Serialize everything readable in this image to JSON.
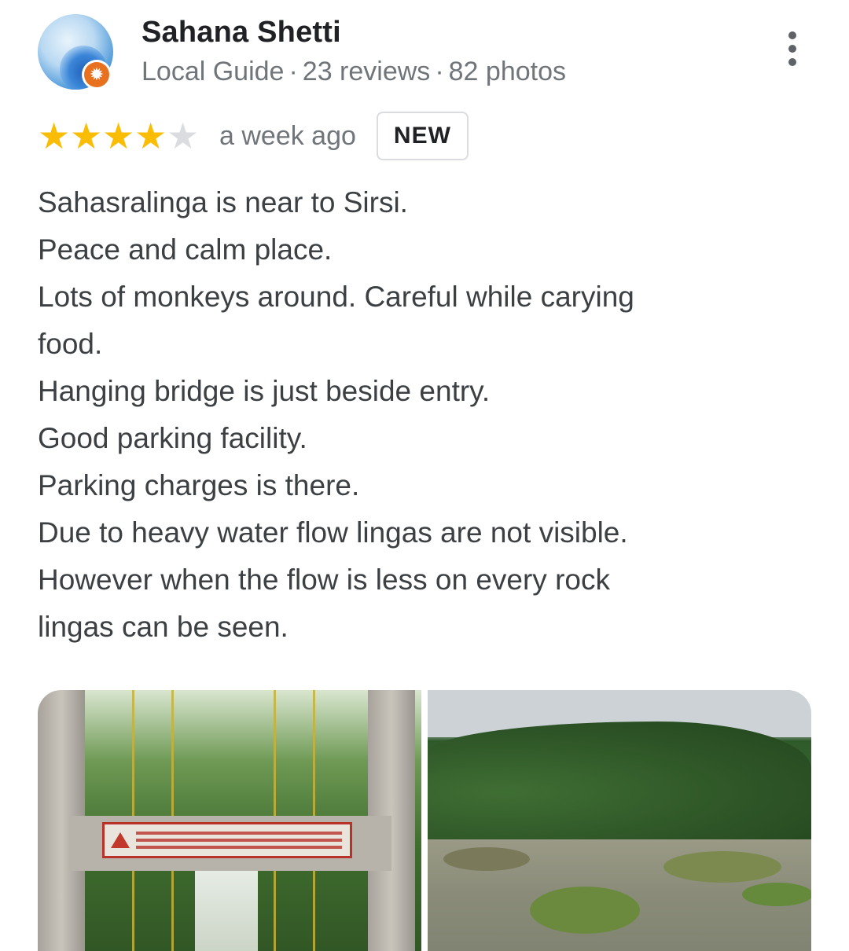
{
  "reviewer": {
    "name": "Sahana Shetti",
    "level": "Local Guide",
    "reviews": "23 reviews",
    "photos": "82 photos",
    "separator": "·"
  },
  "rating": {
    "value": 4,
    "max": 5,
    "time_ago": "a week ago",
    "badge": "NEW"
  },
  "review": {
    "lines": [
      "Sahasralinga is near to Sirsi.",
      "Peace and calm place.",
      "Lots of monkeys around. Careful while carying",
      "food.",
      "Hanging bridge is just beside entry.",
      "Good parking facility.",
      "Parking charges is there.",
      "Due to heavy water flow lingas are not visible.",
      "However when the flow is less on every rock",
      "lingas can be seen."
    ]
  },
  "icons": {
    "more": "more-vert-icon",
    "badge": "local-guide-star-icon",
    "star": "star-icon"
  },
  "colors": {
    "star_filled": "#fbbc04",
    "star_empty": "#dadce0",
    "guide_badge": "#e8711f",
    "secondary_text": "#70757a"
  }
}
